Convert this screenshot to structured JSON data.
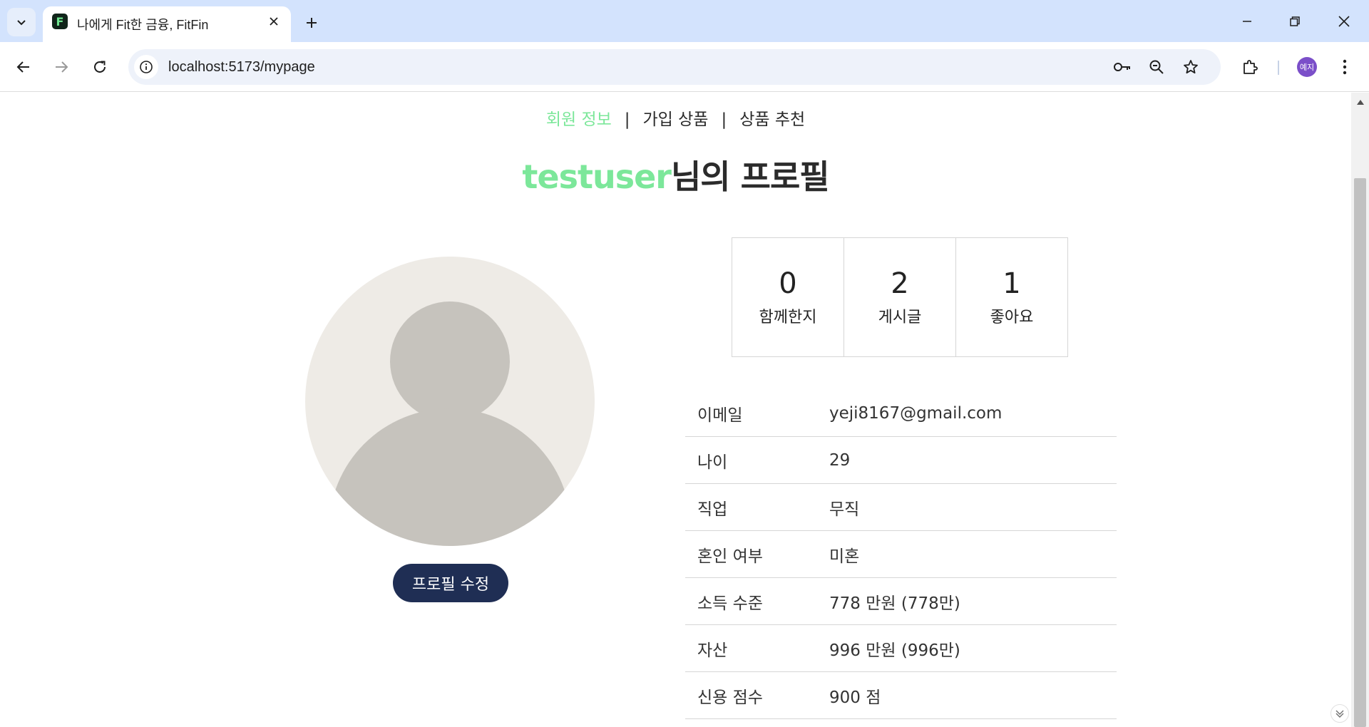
{
  "browser": {
    "tab_title": "나에게 Fit한 금융, FitFin",
    "favicon_letter": "F",
    "url": "localhost:5173/mypage",
    "profile_initials": "예지"
  },
  "subnav": {
    "items": [
      {
        "label": "회원 정보",
        "active": true
      },
      {
        "label": "가입 상품",
        "active": false
      },
      {
        "label": "상품 추천",
        "active": false
      }
    ],
    "separator": "|"
  },
  "heading": {
    "username": "testuser",
    "suffix": "님의 프로필"
  },
  "profile": {
    "edit_button": "프로필 수정"
  },
  "stats": [
    {
      "value": "0",
      "label": "함께한지"
    },
    {
      "value": "2",
      "label": "게시글"
    },
    {
      "value": "1",
      "label": "좋아요"
    }
  ],
  "info": [
    {
      "key": "이메일",
      "value": "yeji8167@gmail.com"
    },
    {
      "key": "나이",
      "value": "29"
    },
    {
      "key": "직업",
      "value": "무직"
    },
    {
      "key": "혼인 여부",
      "value": "미혼"
    },
    {
      "key": "소득 수준",
      "value": "778 만원 (778만)"
    },
    {
      "key": "자산",
      "value": "996 만원 (996만)"
    },
    {
      "key": "신용 점수",
      "value": "900 점"
    }
  ],
  "colors": {
    "accent_green": "#7ce79a",
    "button_navy": "#1f2e54",
    "chrome_blue": "#d3e3fd"
  }
}
